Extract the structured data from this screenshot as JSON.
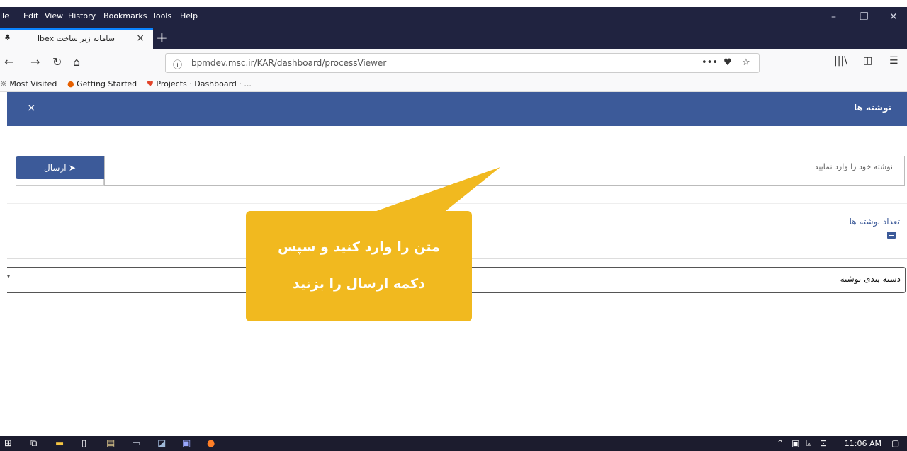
{
  "menubar": {
    "items": [
      "ile",
      "Edit",
      "View",
      "History",
      "Bookmarks",
      "Tools",
      "Help"
    ]
  },
  "tab": {
    "title": "سامانه زیر ساخت lbex",
    "close": "×",
    "new": "+"
  },
  "url": {
    "text": "bpmdev.msc.ir/KAR/dashboard/processViewer"
  },
  "bookmarks": [
    "Most Visited",
    "Getting Started",
    "Projects · Dashboard · ..."
  ],
  "app": {
    "header_title": "نوشته ها",
    "close_glyph": "×",
    "note_placeholder": "نوشته خود را وارد نمایید",
    "send_label": "ارسال ➤",
    "count_label": "تعداد نوشته ها",
    "category_label": "دسته بندی نوشته"
  },
  "callout": {
    "line1": "متن را وارد کنید و سپس",
    "line2": "دکمه ارسال را بزنید"
  },
  "taskbar": {
    "clock": "11:06 AM"
  },
  "colors": {
    "header": "#3c5a99",
    "callout": "#f1b91f",
    "chrome": "#202340"
  }
}
